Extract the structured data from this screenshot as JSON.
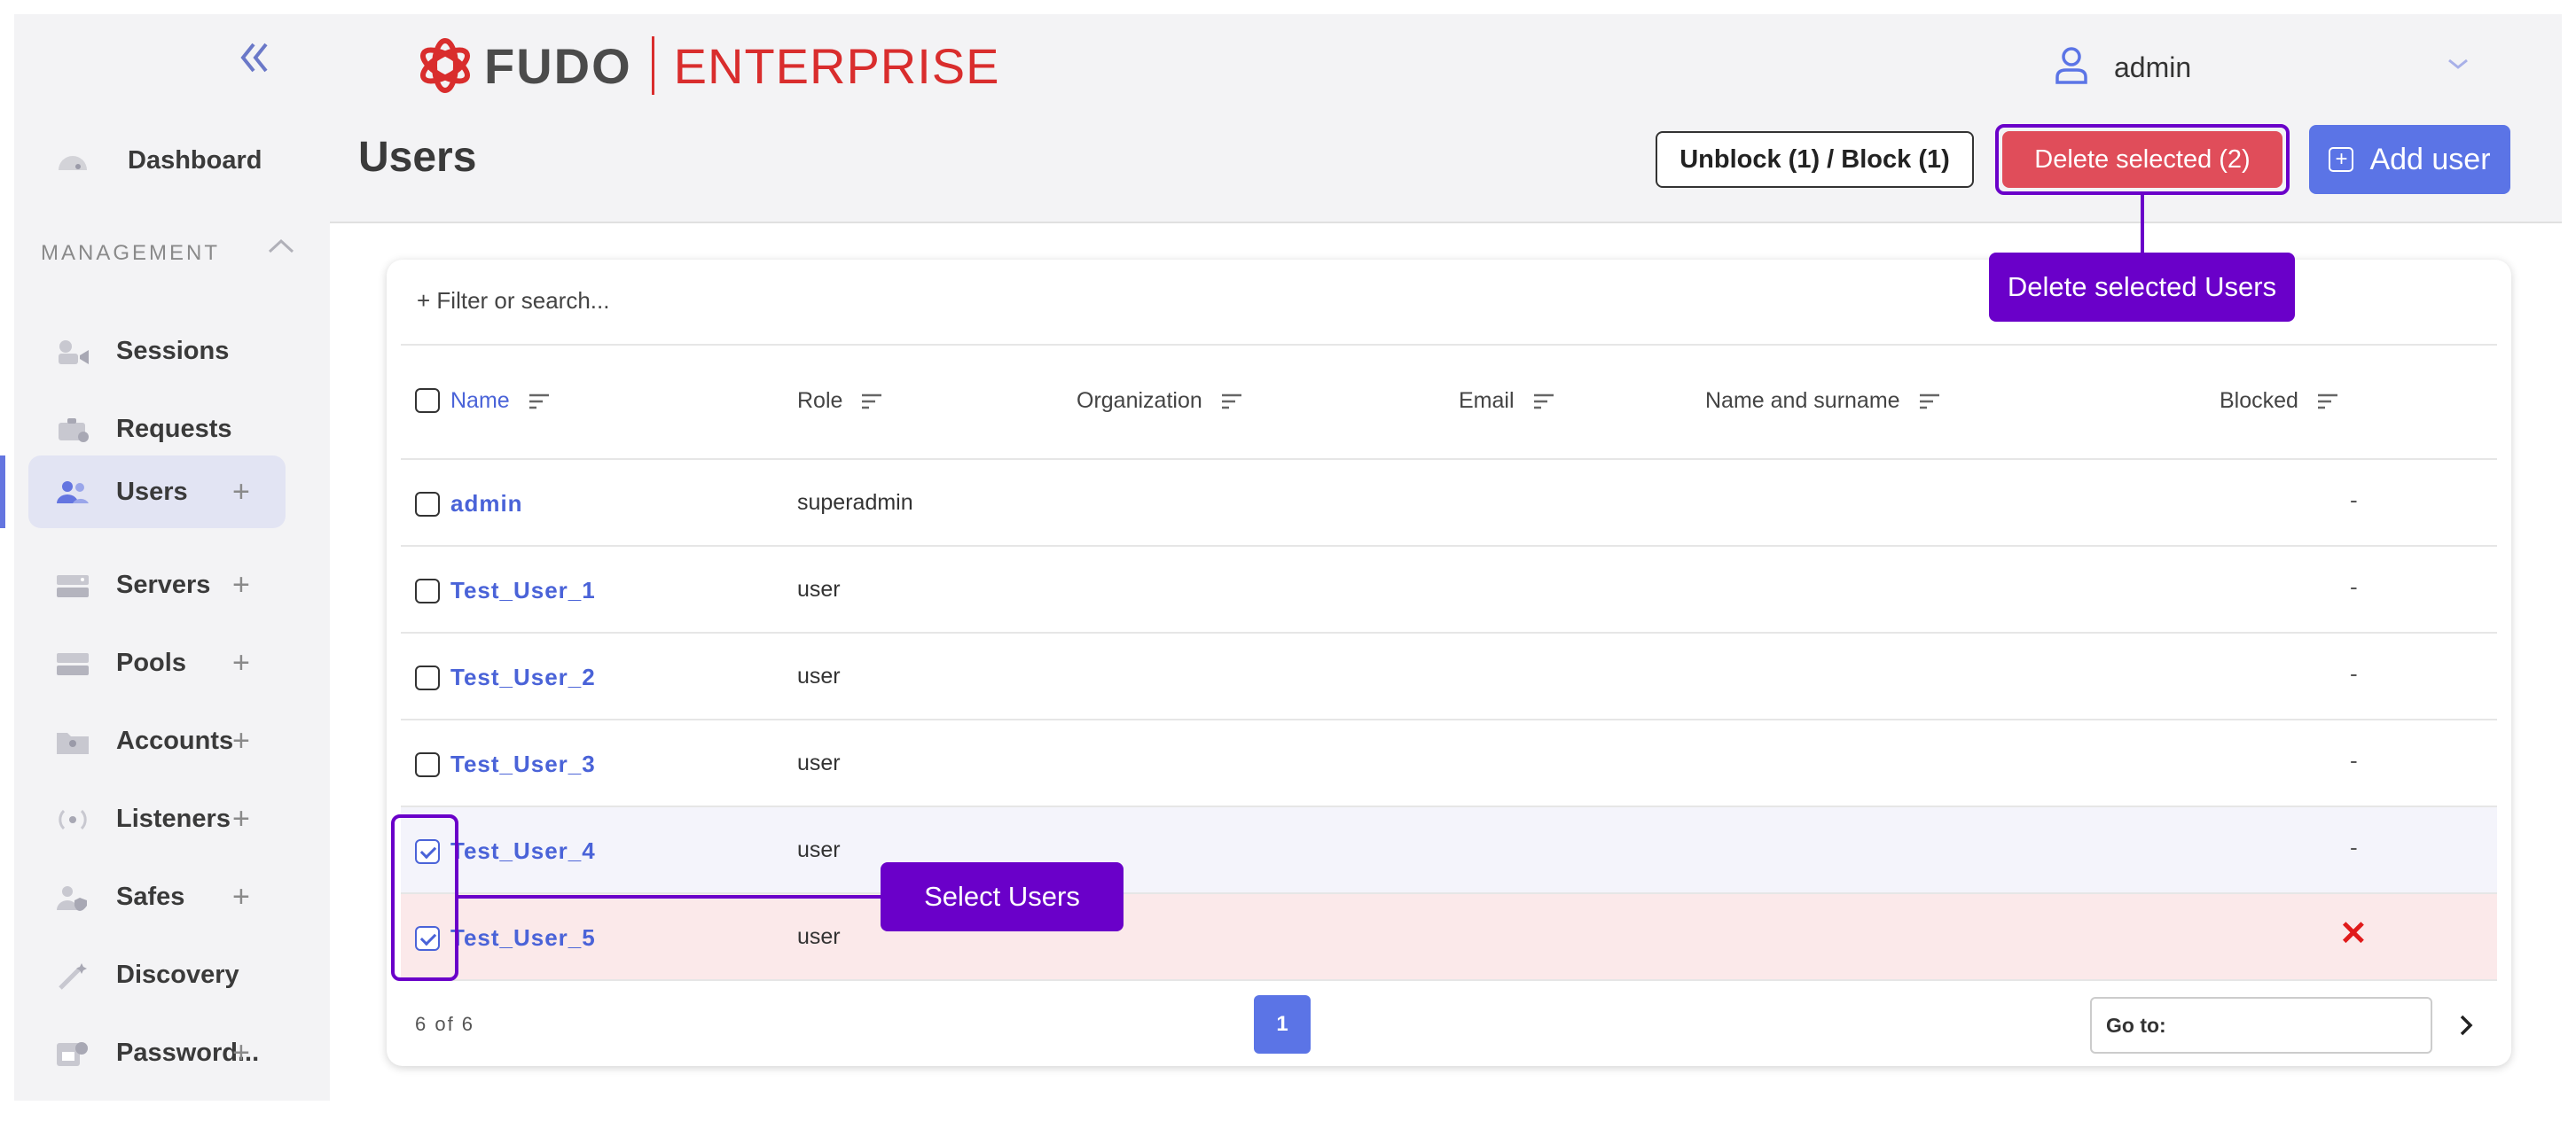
{
  "brand": {
    "name": "FUDO",
    "edition": "ENTERPRISE",
    "accent": "#d92d2d"
  },
  "user_menu": {
    "username": "admin"
  },
  "sidebar": {
    "dashboard": "Dashboard",
    "section": "MANAGEMENT",
    "items": [
      {
        "label": "Sessions",
        "icon": "sessions-icon",
        "plus": ""
      },
      {
        "label": "Requests",
        "icon": "requests-icon",
        "plus": ""
      },
      {
        "label": "Users",
        "icon": "users-icon",
        "plus": "+"
      },
      {
        "label": "Servers",
        "icon": "servers-icon",
        "plus": "+"
      },
      {
        "label": "Pools",
        "icon": "pools-icon",
        "plus": "+"
      },
      {
        "label": "Accounts",
        "icon": "accounts-icon",
        "plus": "+"
      },
      {
        "label": "Listeners",
        "icon": "listeners-icon",
        "plus": "+"
      },
      {
        "label": "Safes",
        "icon": "safes-icon",
        "plus": "+"
      },
      {
        "label": "Discovery",
        "icon": "discovery-icon",
        "plus": ""
      },
      {
        "label": "Password...",
        "icon": "password-icon",
        "plus": "+"
      }
    ],
    "active": "Users"
  },
  "page": {
    "title": "Users",
    "buttons": {
      "block": "Unblock (1) / Block (1)",
      "delete": "Delete selected (2)",
      "add": "Add user"
    },
    "filter_placeholder": "+ Filter or search..."
  },
  "annotations": {
    "delete": "Delete selected Users",
    "select": "Select Users"
  },
  "table": {
    "columns": [
      "Name",
      "Role",
      "Organization",
      "Email",
      "Name and surname",
      "Blocked"
    ],
    "rows": [
      {
        "name": "admin",
        "role": "superadmin",
        "blocked": "-",
        "checked": false
      },
      {
        "name": "Test_User_1",
        "role": "user",
        "blocked": "-",
        "checked": false
      },
      {
        "name": "Test_User_2",
        "role": "user",
        "blocked": "-",
        "checked": false
      },
      {
        "name": "Test_User_3",
        "role": "user",
        "blocked": "-",
        "checked": false
      },
      {
        "name": "Test_User_4",
        "role": "user",
        "blocked": "-",
        "checked": true
      },
      {
        "name": "Test_User_5",
        "role": "user",
        "blocked": "✕",
        "checked": true
      }
    ]
  },
  "pagination": {
    "count": "6 of 6",
    "page": "1",
    "goto_label": "Go to:"
  },
  "colors": {
    "primary": "#5b74e6",
    "danger": "#e04d5a",
    "annotation": "#6a00c9"
  }
}
